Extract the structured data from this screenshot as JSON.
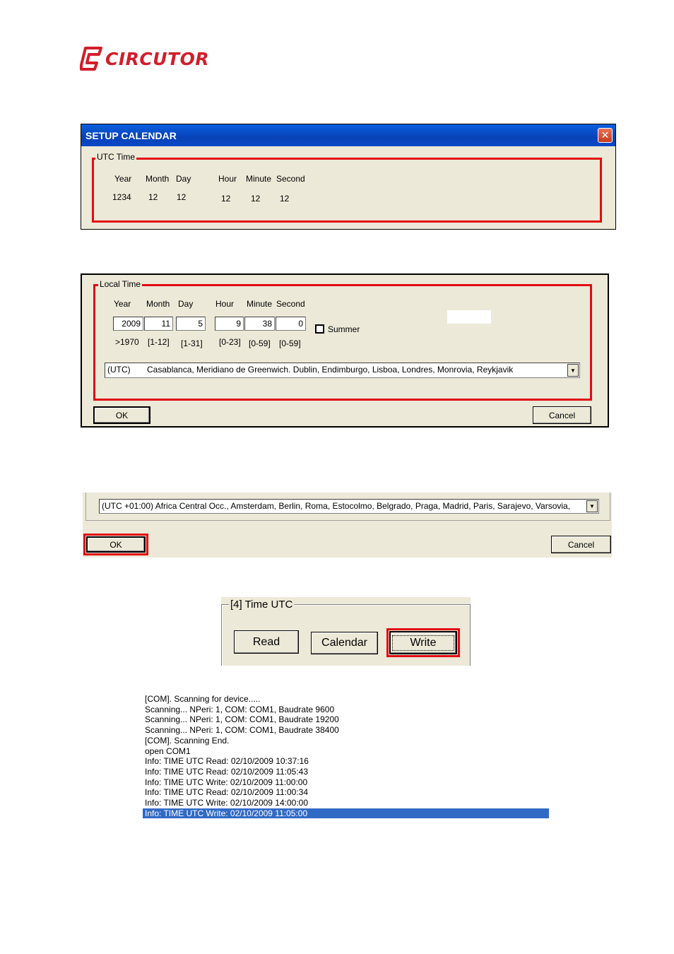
{
  "logo": {
    "text": "CIRCUTOR",
    "icon": "circutor-logo-icon",
    "brand_color": "#d21e2b"
  },
  "setup_calendar": {
    "title": "SETUP CALENDAR",
    "close_icon": "close-icon",
    "group_label": "UTC Time",
    "headers": {
      "year": "Year",
      "month": "Month",
      "day": "Day",
      "hour": "Hour",
      "minute": "Minute",
      "second": "Second"
    },
    "values": {
      "year": "1234",
      "month": "12",
      "day": "12",
      "hour": "12",
      "minute": "12",
      "second": "12"
    }
  },
  "local_time": {
    "group_label": "Local Time",
    "headers": {
      "year": "Year",
      "month": "Month",
      "day": "Day",
      "hour": "Hour",
      "minute": "Minute",
      "second": "Second"
    },
    "fields": {
      "year": "2009",
      "month": "11",
      "day": "5",
      "hour": "9",
      "minute": "38",
      "second": "0"
    },
    "ranges": {
      "year": ">1970",
      "month": "[1-12]",
      "day": "[1-31]",
      "hour": "[0-23]",
      "minute": "[0-59]",
      "second": "[0-59]"
    },
    "summer_label": "Summer",
    "summer_checked": false,
    "timezone_code": "(UTC)",
    "timezone_text": "Casablanca, Meridiano de Greenwich. Dublin, Endimburgo, Lisboa, Londres, Monrovia, Reykjavik",
    "ok_label": "OK",
    "cancel_label": "Cancel"
  },
  "timezone_crop": {
    "timezone_text": "(UTC +01:00) Africa Central Occ., Amsterdam, Berlin, Roma, Estocolmo, Belgrado, Praga, Madrid, Paris, Sarajevo, Varsovia,",
    "ok_label": "OK",
    "cancel_label": "Cancel"
  },
  "time_utc_panel": {
    "group_label": "[4] Time UTC",
    "read_label": "Read",
    "calendar_label": "Calendar",
    "write_label": "Write"
  },
  "log": {
    "lines": [
      "[COM]. Scanning for device.....",
      "Scanning...  NPeri: 1, COM: COM1, Baudrate 9600",
      "Scanning...  NPeri: 1, COM: COM1, Baudrate 19200",
      "Scanning...  NPeri: 1, COM: COM1, Baudrate 38400",
      "[COM]. Scanning End.",
      "open COM1",
      "Info: TIME UTC Read: 02/10/2009 10:37:16",
      "Info: TIME UTC Read: 02/10/2009 11:05:43",
      "Info: TIME UTC Write: 02/10/2009 11:00:00",
      "Info: TIME UTC Read: 02/10/2009 11:00:34",
      "Info: TIME UTC Write: 02/10/2009 14:00:00",
      "Info: TIME UTC Write: 02/10/2009 11:05:00"
    ],
    "selected_index": 11
  },
  "colors": {
    "highlight_red": "#e20a14",
    "selection_blue": "#316ac5",
    "dialog_bg": "#ece9d8"
  }
}
